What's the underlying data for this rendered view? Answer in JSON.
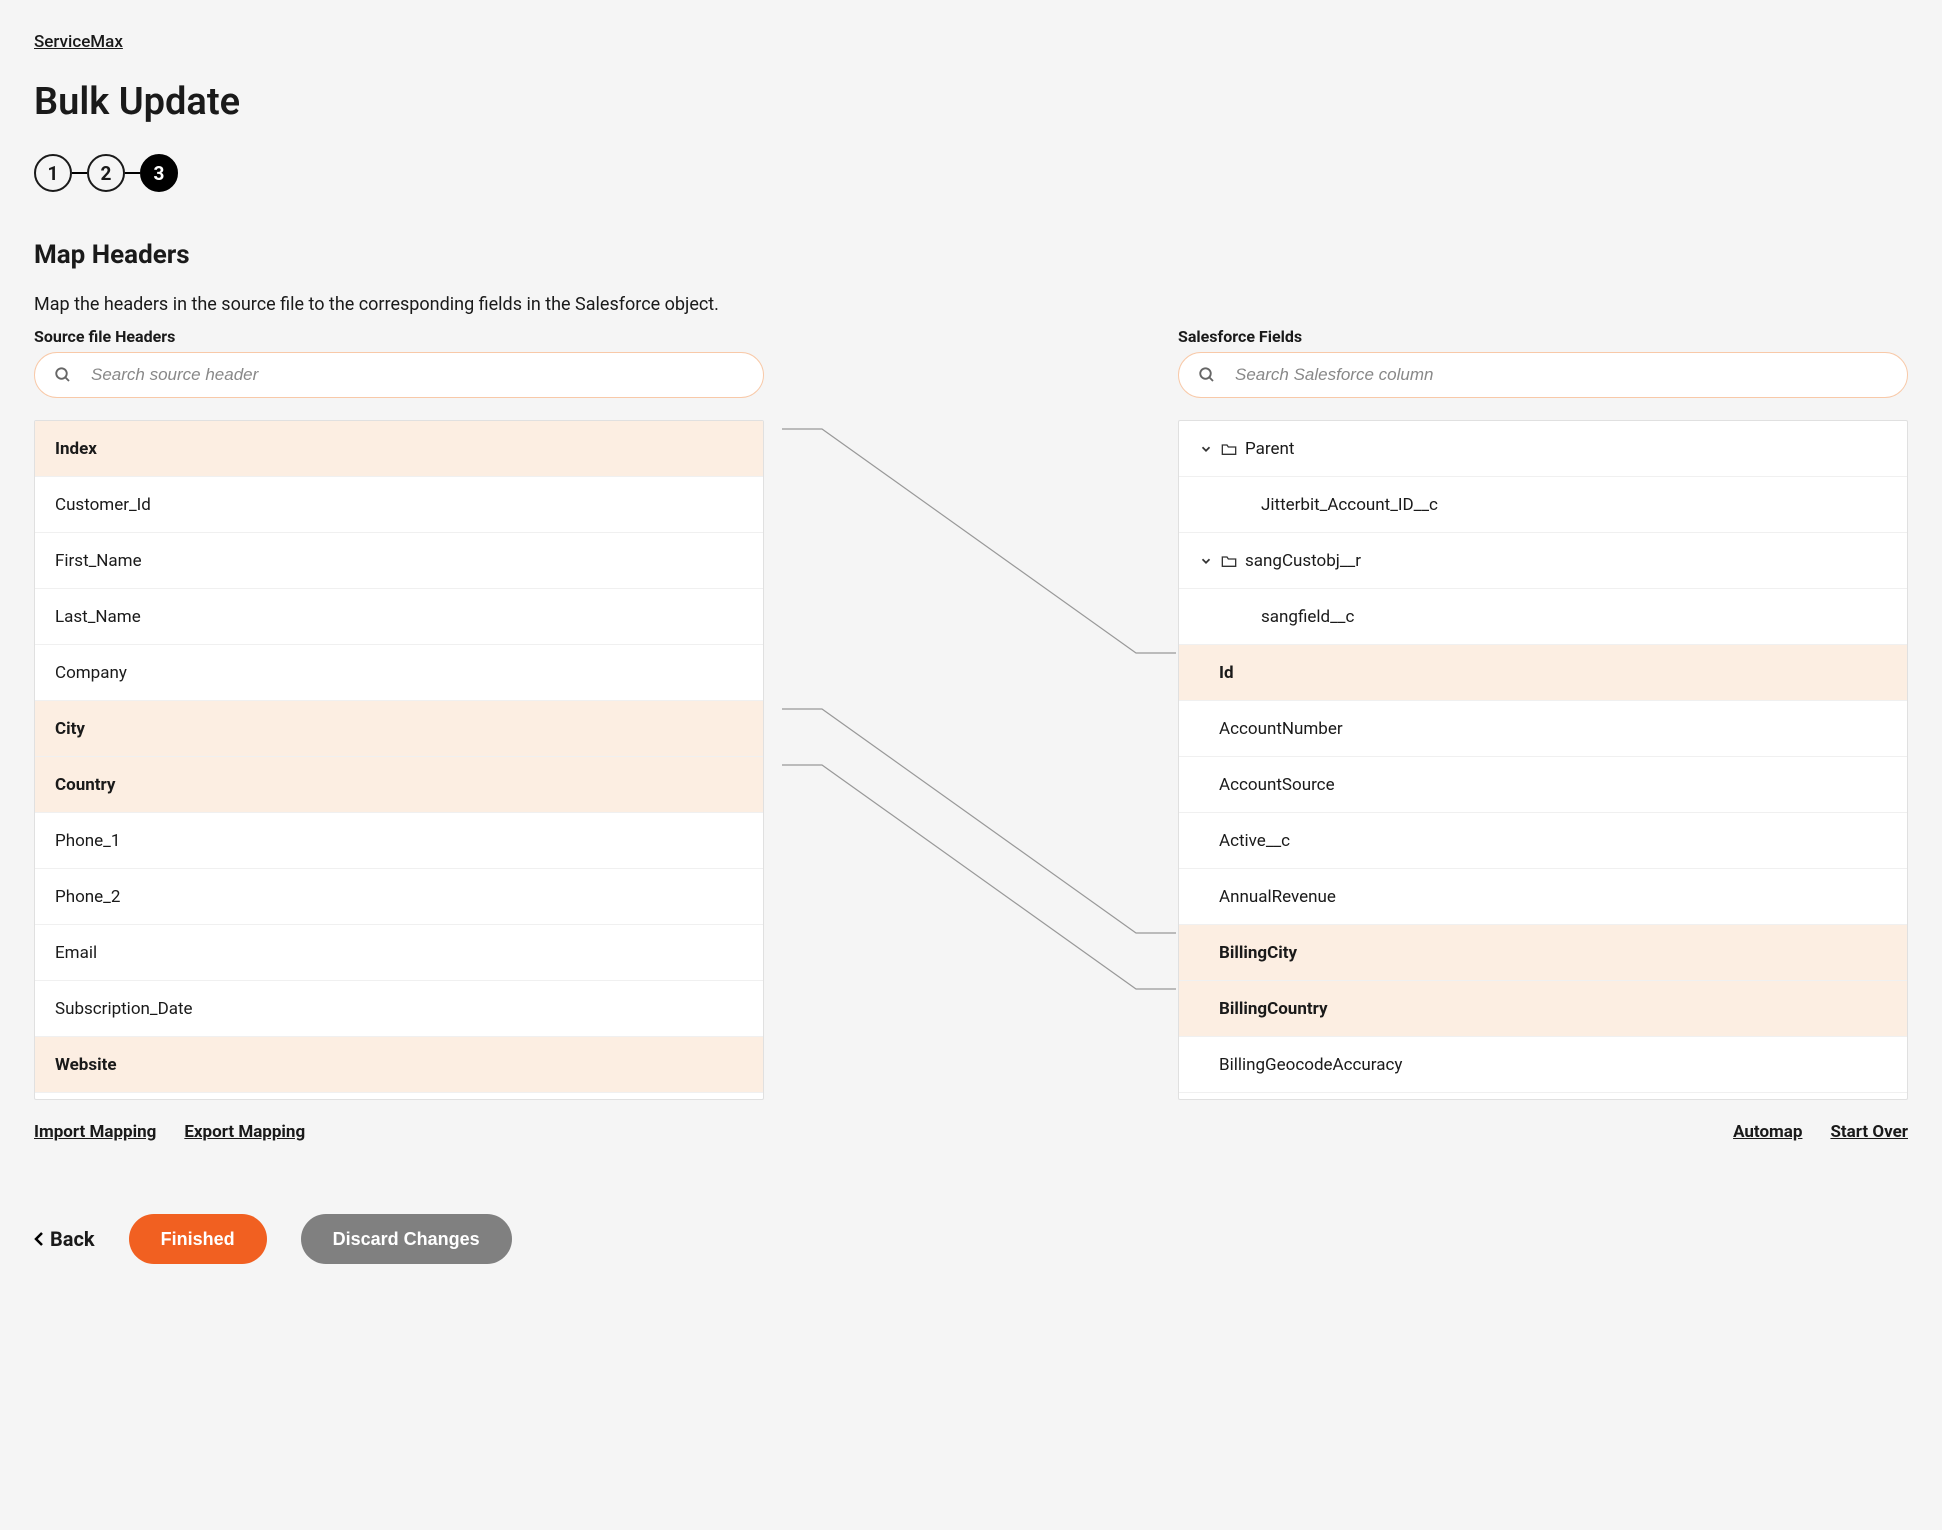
{
  "breadcrumb": "ServiceMax",
  "page_title": "Bulk Update",
  "stepper": {
    "step1": "1",
    "step2": "2",
    "step3": "3"
  },
  "section_title": "Map Headers",
  "section_desc": "Map the headers in the source file to the corresponding fields in the Salesforce object.",
  "source": {
    "label": "Source file Headers",
    "search_placeholder": "Search source header",
    "items": [
      {
        "label": "Index",
        "mapped": true
      },
      {
        "label": "Customer_Id",
        "mapped": false
      },
      {
        "label": "First_Name",
        "mapped": false
      },
      {
        "label": "Last_Name",
        "mapped": false
      },
      {
        "label": "Company",
        "mapped": false
      },
      {
        "label": "City",
        "mapped": true
      },
      {
        "label": "Country",
        "mapped": true
      },
      {
        "label": "Phone_1",
        "mapped": false
      },
      {
        "label": "Phone_2",
        "mapped": false
      },
      {
        "label": "Email",
        "mapped": false
      },
      {
        "label": "Subscription_Date",
        "mapped": false
      },
      {
        "label": "Website",
        "mapped": true
      }
    ]
  },
  "salesforce": {
    "label": "Salesforce Fields",
    "search_placeholder": "Search Salesforce column",
    "tree": {
      "parent_label": "Parent",
      "parent_child": "Jitterbit_Account_ID__c",
      "sang_label": "sangCustobj__r",
      "sang_child": "sangfield__c"
    },
    "items": [
      {
        "label": "Id",
        "mapped": true
      },
      {
        "label": "AccountNumber",
        "mapped": false
      },
      {
        "label": "AccountSource",
        "mapped": false
      },
      {
        "label": "Active__c",
        "mapped": false
      },
      {
        "label": "AnnualRevenue",
        "mapped": false
      },
      {
        "label": "BillingCity",
        "mapped": true
      },
      {
        "label": "BillingCountry",
        "mapped": true
      },
      {
        "label": "BillingGeocodeAccuracy",
        "mapped": false
      }
    ]
  },
  "actions": {
    "import_mapping": "Import Mapping",
    "export_mapping": "Export Mapping",
    "automap": "Automap",
    "start_over": "Start Over"
  },
  "footer": {
    "back": "Back",
    "finished": "Finished",
    "discard": "Discard Changes"
  }
}
